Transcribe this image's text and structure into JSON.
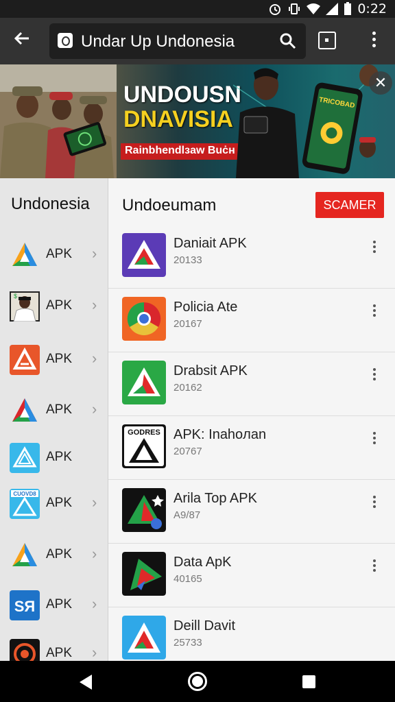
{
  "status_bar": {
    "time": "0:22"
  },
  "browser": {
    "url_text": "Undar Up Undonesia",
    "icons": [
      "back-arrow-icon",
      "site-icon",
      "search-icon",
      "tabs-icon",
      "overflow-menu-icon"
    ]
  },
  "banner": {
    "title_line1": "UNDOUSN",
    "title_line2": "DNAVISIA",
    "subtitle": "Rainbhendlзaw Buċн",
    "phone_text_line1": "TRICOBAD",
    "close_icon": "close-icon"
  },
  "sidebar": {
    "title": "Undonesia",
    "items": [
      {
        "label": "APK",
        "icon": "triangle-logo-icon",
        "colors": [
          "#f7a21b",
          "#2a8de0",
          "#24a148"
        ]
      },
      {
        "label": "APK",
        "icon": "person-photo-icon",
        "colors": [
          "#222222",
          "#ffffff"
        ]
      },
      {
        "label": "APK",
        "icon": "triangle-logo-icon",
        "colors": [
          "#e8562a",
          "#ffffff"
        ]
      },
      {
        "label": "APK",
        "icon": "triangle-logo-icon",
        "colors": [
          "#d9262c",
          "#2a8de0",
          "#24a148"
        ]
      },
      {
        "label": "APK",
        "icon": "triangle-logo-icon",
        "colors": [
          "#38b8ea",
          "#ffffff"
        ]
      },
      {
        "label": "APK",
        "icon": "triangle-logo-icon",
        "colors": [
          "#38b8ea",
          "#ffffff"
        ],
        "badge_text": "CUOVD8"
      },
      {
        "label": "APK",
        "icon": "triangle-logo-icon",
        "colors": [
          "#f7a21b",
          "#2a8de0",
          "#24a148"
        ]
      },
      {
        "label": "APK",
        "icon": "text-logo-icon",
        "colors": [
          "#1e73c8",
          "#ffffff"
        ],
        "logo_text": "SЯ"
      },
      {
        "label": "APK",
        "icon": "gear-logo-icon",
        "colors": [
          "#111111",
          "#e8562a"
        ]
      }
    ]
  },
  "main": {
    "title": "Undoeumam",
    "action_button": "SCAMER",
    "action_color": "#e52620",
    "apps": [
      {
        "name": "Daniait APK",
        "sub": "20133",
        "icon": "triangle-logo-icon",
        "bg": "#5b3bb6"
      },
      {
        "name": "Policia Ate",
        "sub": "20167",
        "icon": "chrome-like-icon",
        "bg": "#f06524"
      },
      {
        "name": "Drabsit APK",
        "sub": "20162",
        "icon": "triangle-logo-icon",
        "bg": "#2aa845"
      },
      {
        "name": "APK: Inahoлan",
        "sub": "20767",
        "icon": "triangle-logo-icon",
        "bg": "#111111",
        "logo_text": "GODRES"
      },
      {
        "name": "Arila Top APK",
        "sub": "A9/87",
        "icon": "triangle-logo-icon",
        "bg": "#111111"
      },
      {
        "name": "Data ApK",
        "sub": "40165",
        "icon": "triangle-logo-icon",
        "bg": "#111111"
      },
      {
        "name": "Deill Davit",
        "sub": "25733",
        "icon": "triangle-logo-icon",
        "bg": "#2fa8e8"
      }
    ]
  },
  "nav_bar": {
    "icons": [
      "nav-back-icon",
      "nav-home-icon",
      "nav-recent-icon"
    ]
  }
}
